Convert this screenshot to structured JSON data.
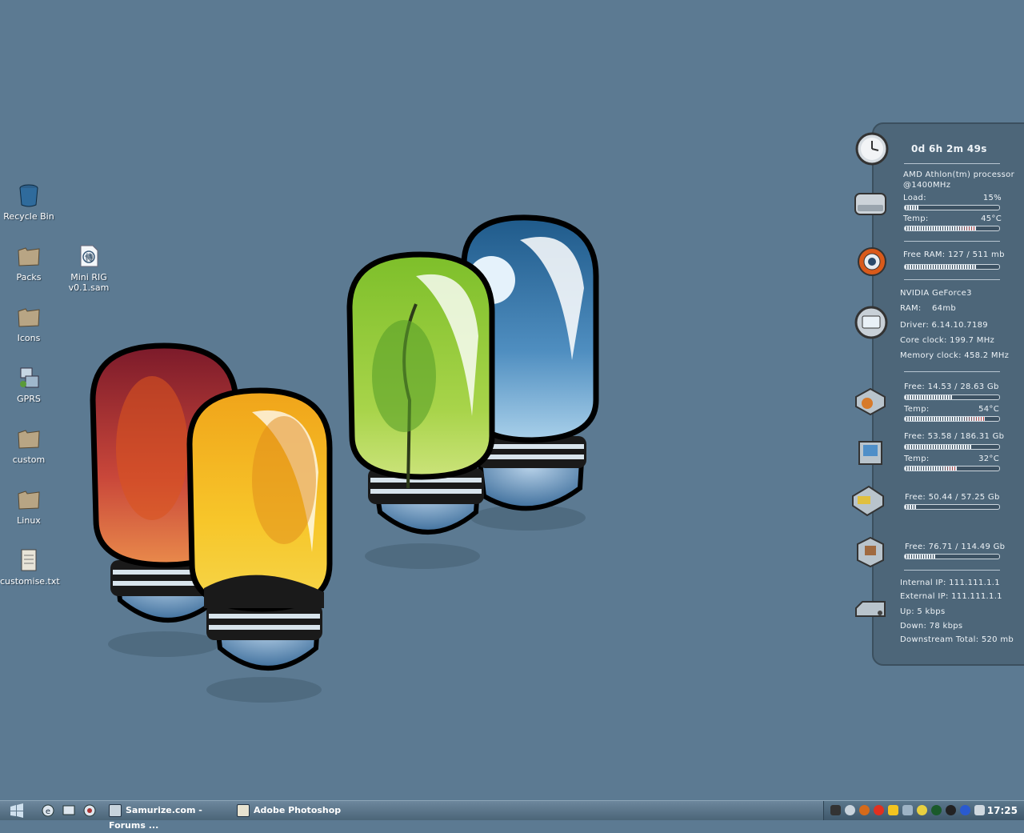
{
  "desktop": {
    "icons": [
      {
        "label": "Recycle Bin",
        "icon": "recycle-bin-icon"
      },
      {
        "label": "Packs",
        "icon": "folder-icon"
      },
      {
        "label": "Icons",
        "icon": "folder-icon"
      },
      {
        "label": "GPRS",
        "icon": "network-icon"
      },
      {
        "label": "custom",
        "icon": "folder-icon"
      },
      {
        "label": "Linux",
        "icon": "folder-icon"
      },
      {
        "label": "customise.txt",
        "icon": "text-file-icon"
      },
      {
        "label": "Mini RIG v0.1.sam",
        "icon": "samurize-file-icon"
      }
    ]
  },
  "panel": {
    "uptime": "0d 6h 2m 49s",
    "cpu": {
      "name": "AMD Athlon(tm) processor",
      "speed": "@1400MHz",
      "load_label": "Load:",
      "load_value": "15%",
      "load_fraction": 0.15,
      "temp_label": "Temp:",
      "temp_value": "45°C",
      "temp_fraction": 0.75
    },
    "ram": {
      "text": "Free RAM: 127 /  511 mb",
      "fraction": 0.75
    },
    "gpu": {
      "name": "NVIDIA GeForce3",
      "ram_label": "RAM:",
      "ram_value": "64mb",
      "driver": "Driver: 6.14.10.7189",
      "core_clock": "Core clock: 199.7 MHz",
      "memory_clock": "Memory clock: 458.2 MHz"
    },
    "drives": [
      {
        "free": "Free: 14.53 / 28.63 Gb",
        "fraction": 0.5,
        "temp_label": "Temp:",
        "temp_value": "54°C",
        "temp_fraction": 0.85
      },
      {
        "free": "Free: 53.58 / 186.31 Gb",
        "fraction": 0.71,
        "temp_label": "Temp:",
        "temp_value": "32°C",
        "temp_fraction": 0.55
      },
      {
        "free": "Free: 50.44 / 57.25 Gb",
        "fraction": 0.12
      },
      {
        "free": "Free: 76.71 / 114.49 Gb",
        "fraction": 0.33
      }
    ],
    "network": {
      "internal_ip": "Internal IP: 111.111.1.1",
      "external_ip": "External IP: 111.111.1.1",
      "up": "Up: 5 kbps",
      "down": "Down: 78 kbps",
      "total": "Downstream Total:  520 mb"
    }
  },
  "taskbar": {
    "tasks": [
      {
        "label": "Samurize.com - Forums ...",
        "icon": "browser-window-icon"
      },
      {
        "label": "Adobe Photoshop",
        "icon": "photoshop-icon"
      }
    ],
    "clock": "17:25"
  },
  "colors": {
    "desktop": "#5c7a92",
    "panel": "#4d6679",
    "taskbar": "#5b7388"
  }
}
